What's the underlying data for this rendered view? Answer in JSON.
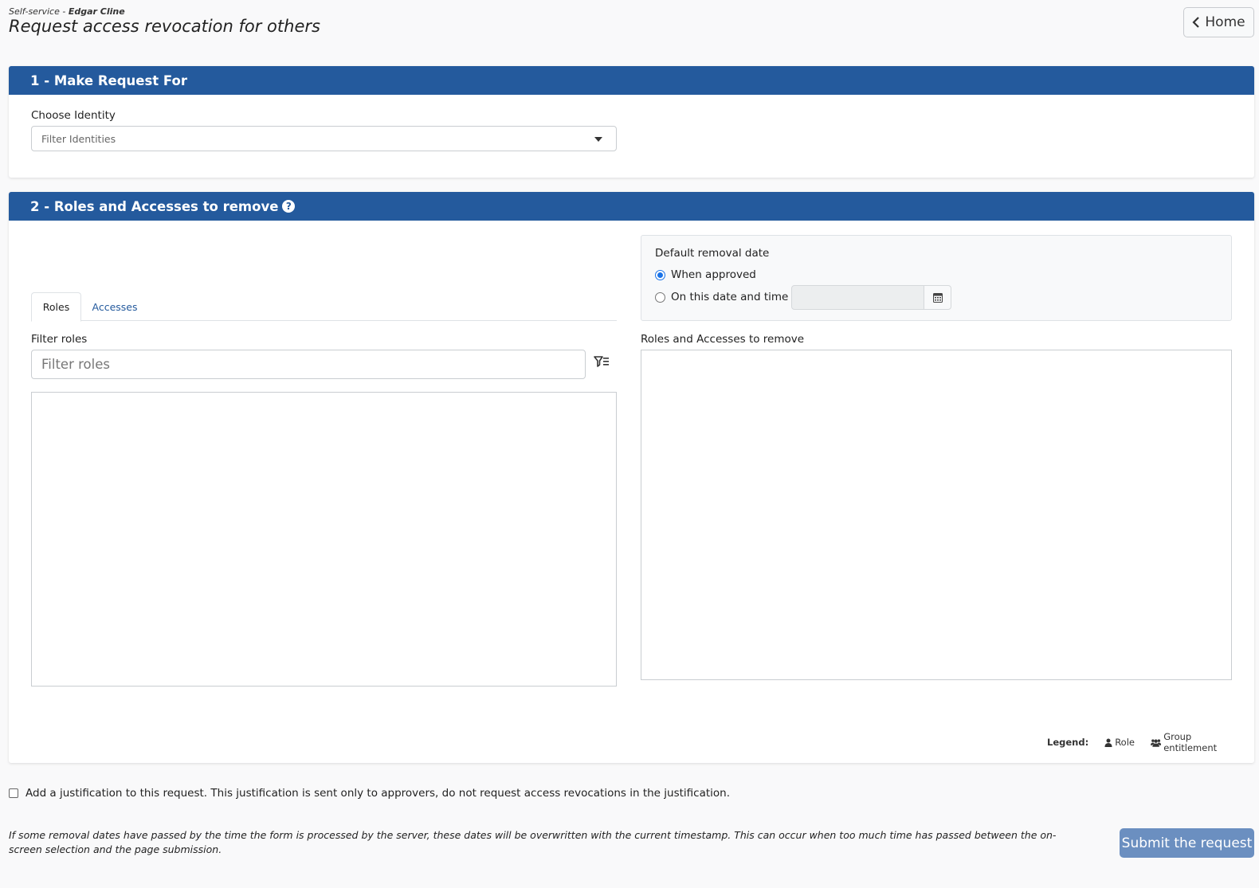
{
  "header": {
    "breadcrumb_prefix": "Self-service - ",
    "breadcrumb_user": "Edgar Cline",
    "title": "Request access revocation for others",
    "home_label": "Home"
  },
  "section1": {
    "title": "1 - Make Request For",
    "identity_label": "Choose Identity",
    "identity_placeholder": "Filter Identities"
  },
  "section2": {
    "title": "2 - Roles and Accesses to remove",
    "date_box": {
      "title": "Default removal date",
      "option_approved": "When approved",
      "option_date": "On this date and time",
      "selected": "When approved"
    },
    "tabs": [
      {
        "label": "Roles",
        "active": true
      },
      {
        "label": "Accesses",
        "active": false
      }
    ],
    "filter_label": "Filter roles",
    "filter_placeholder": "Filter roles",
    "remove_label": "Roles and Accesses to remove",
    "legend": {
      "title": "Legend:",
      "role": "Role",
      "group": "Group entitlement"
    }
  },
  "footer": {
    "justification": "Add a justification to this request. This justification is sent only to approvers, do not request access revocations in the justification.",
    "note": "If some removal dates have passed by the time the form is processed by the server, these dates will be overwritten with the current timestamp. This can occur when too much time has passed between the on-screen selection and the page submission.",
    "submit_label": "Submit the request"
  },
  "colors": {
    "panel_header": "#245a9d",
    "submit": "#6b8fc0",
    "radio_selected": "#1a73e8"
  }
}
